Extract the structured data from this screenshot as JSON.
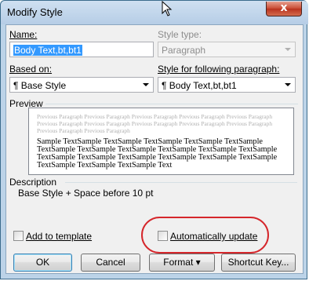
{
  "window": {
    "title": "Modify Style",
    "close_glyph": "x"
  },
  "name_field": {
    "label": "Name:",
    "value": "Body Text,bt,bt1"
  },
  "style_type": {
    "label": "Style type:",
    "value": "Paragraph"
  },
  "based_on": {
    "label": "Based on:",
    "value": "¶ Base Style"
  },
  "following": {
    "label": "Style for following paragraph:",
    "value": "¶ Body Text,bt,bt1"
  },
  "preview": {
    "label": "Preview",
    "previous_text": "Previous Paragraph Previous Paragraph Previous Paragraph Previous Paragraph Previous Paragraph Previous Paragraph Previous Paragraph Previous Paragraph Previous Paragraph Previous Paragraph Previous Paragraph Previous Paragraph",
    "sample_text": "Sample TextSample TextSample TextSample TextSample TextSample TextSample TextSample TextSample TextSample TextSample TextSample TextSample TextSample TextSample TextSample TextSample TextSample TextSample TextSample TextSample Text"
  },
  "description": {
    "label": "Description",
    "text": "Base Style + Space before 10 pt"
  },
  "options": {
    "add_to_template": "Add to template",
    "auto_update": "Automatically update"
  },
  "buttons": {
    "ok": "OK",
    "cancel": "Cancel",
    "format": "Format",
    "format_arrow": "▾",
    "shortcut": "Shortcut Key..."
  },
  "colors": {
    "highlight_ring": "#d5262b",
    "selection": "#3399ff"
  }
}
